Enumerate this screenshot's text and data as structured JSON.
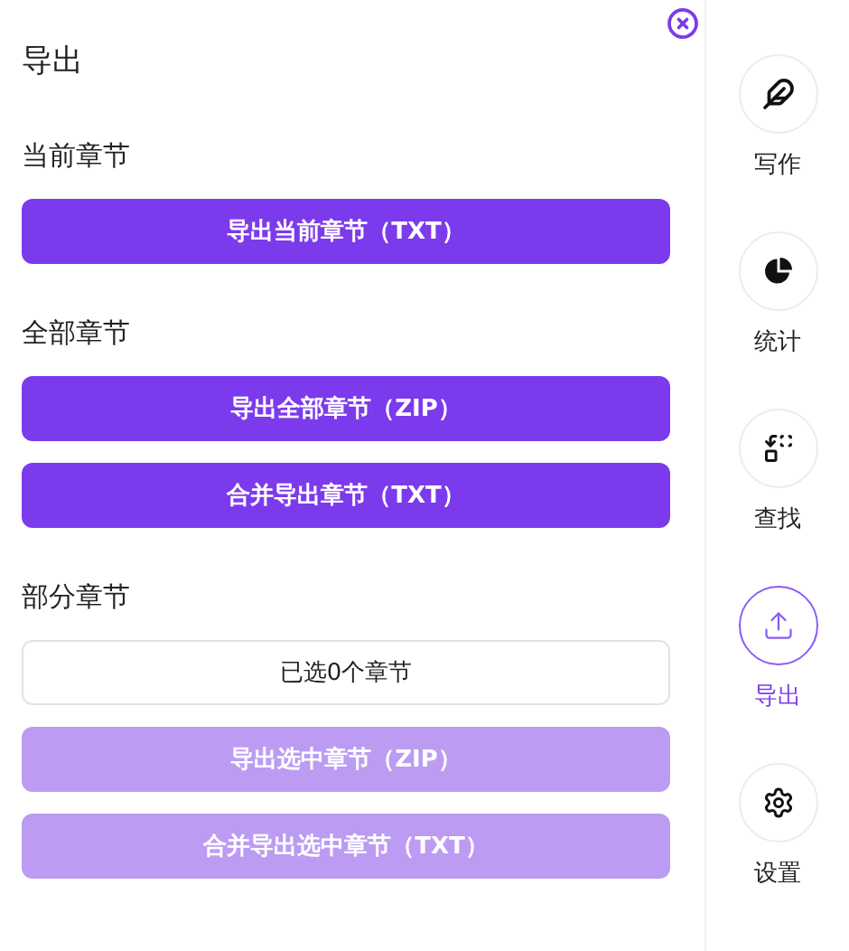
{
  "panel": {
    "title": "导出"
  },
  "sections": [
    {
      "label": "当前章节",
      "controls": [
        {
          "kind": "button",
          "label": "导出当前章节（TXT）",
          "disabled": false
        }
      ]
    },
    {
      "label": "全部章节",
      "controls": [
        {
          "kind": "button",
          "label": "导出全部章节（ZIP）",
          "disabled": false
        },
        {
          "kind": "button",
          "label": "合并导出章节（TXT）",
          "disabled": false
        }
      ]
    },
    {
      "label": "部分章节",
      "controls": [
        {
          "kind": "selector",
          "label": "已选0个章节"
        },
        {
          "kind": "button",
          "label": "导出选中章节（ZIP）",
          "disabled": true
        },
        {
          "kind": "button",
          "label": "合并导出选中章节（TXT）",
          "disabled": true
        }
      ]
    }
  ],
  "sidebar": {
    "items": [
      {
        "kind": "write",
        "label": "写作",
        "selected": false
      },
      {
        "kind": "stats",
        "label": "统计",
        "selected": false
      },
      {
        "kind": "find",
        "label": "查找",
        "selected": false
      },
      {
        "kind": "export",
        "label": "导出",
        "selected": true
      },
      {
        "kind": "settings",
        "label": "设置",
        "selected": false
      }
    ]
  }
}
